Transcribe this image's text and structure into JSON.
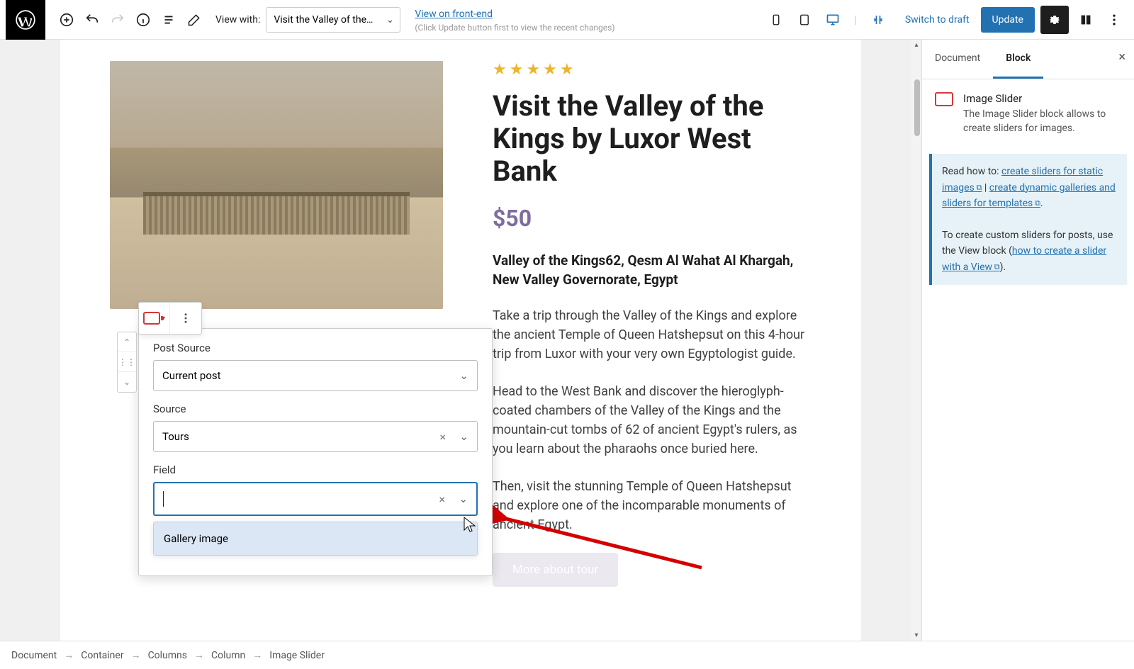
{
  "toolbar": {
    "view_with_label": "View with:",
    "view_with_value": "Visit the Valley of the…",
    "front_end_link": "View on front-end",
    "front_end_hint": "(Click Update button first to view the recent changes)",
    "switch_draft": "Switch to draft",
    "update": "Update"
  },
  "content": {
    "stars": "★★★★★",
    "title": "Visit the Valley of the Kings by Luxor West Bank",
    "price": "$50",
    "location": "Valley of the Kings62, Qesm Al Wahat Al Khargah, New Valley Governorate, Egypt",
    "p1": "Take a trip through the Valley of the Kings and explore the ancient Temple of Queen Hatshepsut on this 4-hour trip from Luxor with your very own Egyptologist guide.",
    "p2": "Head to the West Bank and discover the hieroglyph-coated chambers of the Valley of the Kings and the mountain-cut tombs of 62 of ancient Egypt's rulers, as you learn about the pharaohs once buried here.",
    "p3": "Then, visit the stunning Temple of Queen Hatshepsut and explore one of the incomparable monuments of ancient Egypt.",
    "cta": "More about tour"
  },
  "popover": {
    "post_source_label": "Post Source",
    "post_source_value": "Current post",
    "source_label": "Source",
    "source_value": "Tours",
    "field_label": "Field",
    "field_value": "",
    "option1": "Gallery image"
  },
  "sidebar": {
    "tab_document": "Document",
    "tab_block": "Block",
    "block_name": "Image Slider",
    "block_desc": "The Image Slider block allows to create sliders for images.",
    "notice_lead": "Read how to: ",
    "link1": "create sliders for static images",
    "sep": " | ",
    "link2": "create dynamic galleries and sliders for templates",
    "notice2a": "To create custom sliders for posts, use the View block (",
    "link3": "how to create a slider with a View",
    "notice2b": ")."
  },
  "breadcrumb": {
    "i0": "Document",
    "i1": "Container",
    "i2": "Columns",
    "i3": "Column",
    "i4": "Image Slider"
  }
}
